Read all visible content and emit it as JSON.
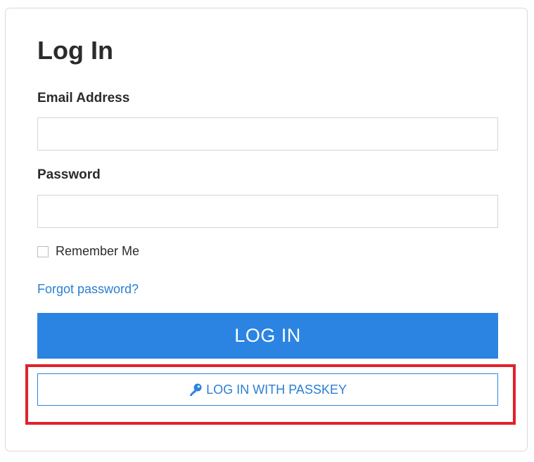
{
  "form": {
    "title": "Log In",
    "email_label": "Email Address",
    "email_value": "",
    "password_label": "Password",
    "password_value": "",
    "remember_label": "Remember Me",
    "forgot_label": "Forgot password?",
    "login_button_label": "LOG IN",
    "passkey_button_label": "LOG IN WITH PASSKEY",
    "passkey_icon": "key-icon"
  },
  "colors": {
    "primary": "#2b84e1",
    "link": "#2a7fd4",
    "highlight": "#e0222a",
    "text": "#2b2b2b"
  }
}
